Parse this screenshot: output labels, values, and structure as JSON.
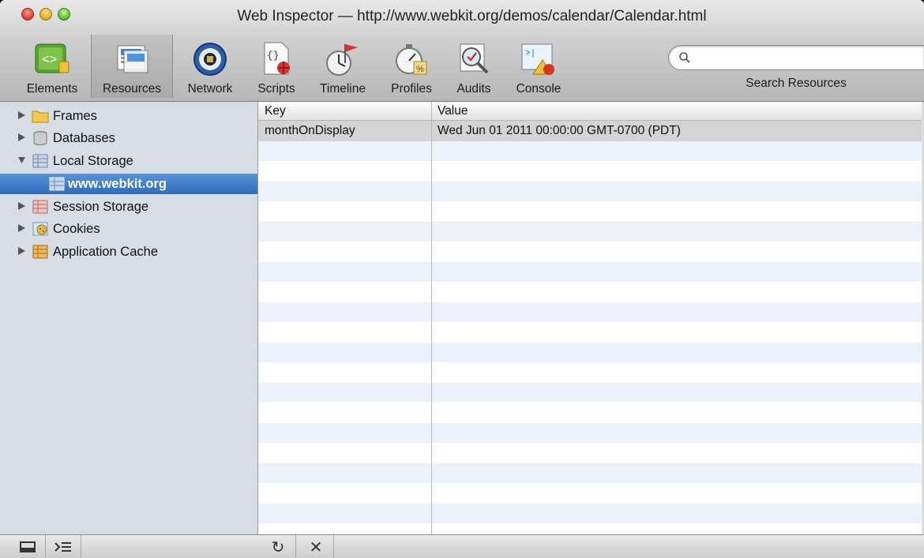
{
  "window": {
    "title": "Web Inspector — http://www.webkit.org/demos/calendar/Calendar.html"
  },
  "toolbar": {
    "tools": [
      {
        "label": "Elements",
        "icon": "elements-icon"
      },
      {
        "label": "Resources",
        "icon": "resources-icon",
        "selected": true
      },
      {
        "label": "Network",
        "icon": "network-icon"
      },
      {
        "label": "Scripts",
        "icon": "scripts-icon"
      },
      {
        "label": "Timeline",
        "icon": "timeline-icon"
      },
      {
        "label": "Profiles",
        "icon": "profiles-icon"
      },
      {
        "label": "Audits",
        "icon": "audits-icon"
      },
      {
        "label": "Console",
        "icon": "console-icon"
      }
    ],
    "search": {
      "label": "Search Resources",
      "value": "",
      "icon": "magnifier-icon"
    }
  },
  "sidebar": {
    "items": [
      {
        "label": "Frames",
        "icon": "folder-icon",
        "expanded": false
      },
      {
        "label": "Databases",
        "icon": "database-icon",
        "expanded": false
      },
      {
        "label": "Local Storage",
        "icon": "storage-grid-icon",
        "expanded": true
      },
      {
        "label": "www.webkit.org",
        "icon": "storage-grid-icon",
        "selected": true
      },
      {
        "label": "Session Storage",
        "icon": "session-storage-icon",
        "expanded": false
      },
      {
        "label": "Cookies",
        "icon": "cookie-icon",
        "expanded": false
      },
      {
        "label": "Application Cache",
        "icon": "app-cache-icon",
        "expanded": false
      }
    ]
  },
  "grid": {
    "columns": [
      "Key",
      "Value"
    ],
    "rows": [
      {
        "key": "monthOnDisplay",
        "value": "Wed Jun 01 2011 00:00:00 GMT-0700 (PDT)"
      }
    ]
  },
  "statusbar": {
    "buttons": [
      {
        "icon": "dock-toggle-icon"
      },
      {
        "icon": "console-drawer-icon"
      },
      {
        "icon": "refresh-icon",
        "glyph": "↻"
      },
      {
        "icon": "delete-icon",
        "glyph": "✕"
      }
    ]
  },
  "colors": {
    "selection": "#2f6bbd",
    "sidebar": "#d6dde5",
    "stripe": "#ebf2fb"
  }
}
